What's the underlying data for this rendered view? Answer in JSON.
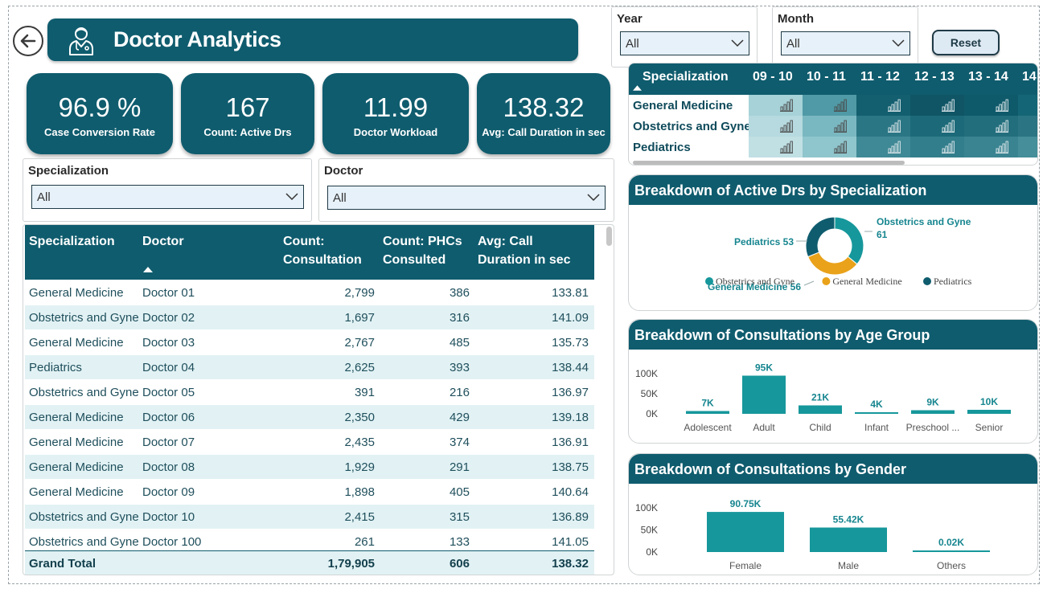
{
  "header": {
    "title": "Doctor Analytics"
  },
  "kpis": [
    {
      "value": "96.9 %",
      "label": "Case Conversion Rate"
    },
    {
      "value": "167",
      "label": "Count: Active Drs"
    },
    {
      "value": "11.99",
      "label": "Doctor Workload"
    },
    {
      "value": "138.32",
      "label": "Avg: Call Duration in sec"
    }
  ],
  "filters": {
    "year": {
      "label": "Year",
      "value": "All"
    },
    "month": {
      "label": "Month",
      "value": "All"
    },
    "specialization": {
      "label": "Specialization",
      "value": "All"
    },
    "doctor": {
      "label": "Doctor",
      "value": "All"
    },
    "reset_label": "Reset"
  },
  "table": {
    "columns": [
      "Specialization",
      "Doctor",
      "Count: Consultation",
      "Count: PHCs Consulted",
      "Avg: Call Duration in sec"
    ],
    "rows": [
      [
        "General Medicine",
        "Doctor 01",
        "2,799",
        "386",
        "133.81"
      ],
      [
        "Obstetrics and Gyne",
        "Doctor 02",
        "1,697",
        "316",
        "141.09"
      ],
      [
        "General Medicine",
        "Doctor 03",
        "2,767",
        "485",
        "135.73"
      ],
      [
        "Pediatrics",
        "Doctor 04",
        "2,625",
        "393",
        "138.44"
      ],
      [
        "Obstetrics and Gyne",
        "Doctor 05",
        "391",
        "216",
        "136.97"
      ],
      [
        "General Medicine",
        "Doctor 06",
        "2,350",
        "429",
        "139.18"
      ],
      [
        "General Medicine",
        "Doctor 07",
        "2,435",
        "374",
        "136.91"
      ],
      [
        "General Medicine",
        "Doctor 08",
        "1,929",
        "291",
        "138.75"
      ],
      [
        "General Medicine",
        "Doctor 09",
        "1,898",
        "405",
        "140.64"
      ],
      [
        "Obstetrics and Gyne",
        "Doctor 10",
        "2,415",
        "315",
        "136.89"
      ],
      [
        "Obstetrics and Gyne",
        "Doctor 100",
        "261",
        "133",
        "141.05"
      ]
    ],
    "grand_total": {
      "label": "Grand Total",
      "consultation": "1,79,905",
      "phcs": "606",
      "avg_call": "138.32"
    }
  },
  "matrix": {
    "row_header": "Specialization",
    "columns": [
      "09 - 10",
      "10 - 11",
      "11 - 12",
      "12 - 13",
      "13 - 14",
      "14"
    ],
    "rows": [
      "General Medicine",
      "Obstetrics and Gyne",
      "Pediatrics"
    ],
    "cell_icon": "bar-signal-icon",
    "shades": [
      [
        "#a6d2d8",
        "#4f9aa6",
        "#135f70",
        "#0f5566",
        "#0f5a6a",
        "#146676"
      ],
      [
        "#b6dadf",
        "#7ab8c1",
        "#2b7685",
        "#1c6a79",
        "#236e7d",
        "#2a7483"
      ],
      [
        "#c0e0e4",
        "#8fc5cc",
        "#3f8996",
        "#337e8c",
        "#3a8491",
        "#458e9a"
      ]
    ]
  },
  "chart_active_drs": {
    "title": "Breakdown of Active Drs by Specialization",
    "chart_data": {
      "type": "pie",
      "categories": [
        "Obstetrics and Gyne",
        "General Medicine",
        "Pediatrics"
      ],
      "values": [
        61,
        56,
        53
      ],
      "labels": [
        "Obstetrics and Gyne 61",
        "General Medicine 56",
        "Pediatrics 53"
      ],
      "colors": [
        "#16979b",
        "#e9a21a",
        "#0f5c6e"
      ],
      "legend": "bottom"
    }
  },
  "chart_age": {
    "title": "Breakdown of Consultations by Age Group",
    "chart_data": {
      "type": "bar",
      "categories": [
        "Adolescent",
        "Adult",
        "Child",
        "Infant",
        "Preschool ...",
        "Senior"
      ],
      "values": [
        7000,
        95000,
        21000,
        4000,
        9000,
        10000
      ],
      "data_labels": [
        "7K",
        "95K",
        "21K",
        "4K",
        "9K",
        "10K"
      ],
      "yticks": [
        "0K",
        "50K",
        "100K"
      ],
      "ylim": [
        0,
        100000
      ],
      "color": "#16979b"
    }
  },
  "chart_gender": {
    "title": "Breakdown of Consultations by Gender",
    "chart_data": {
      "type": "bar",
      "categories": [
        "Female",
        "Male",
        "Others"
      ],
      "values": [
        90750,
        55420,
        20
      ],
      "data_labels": [
        "90.75K",
        "55.42K",
        "0.02K"
      ],
      "yticks": [
        "0K",
        "50K",
        "100K"
      ],
      "ylim": [
        0,
        100000
      ],
      "color": "#16979b"
    }
  }
}
